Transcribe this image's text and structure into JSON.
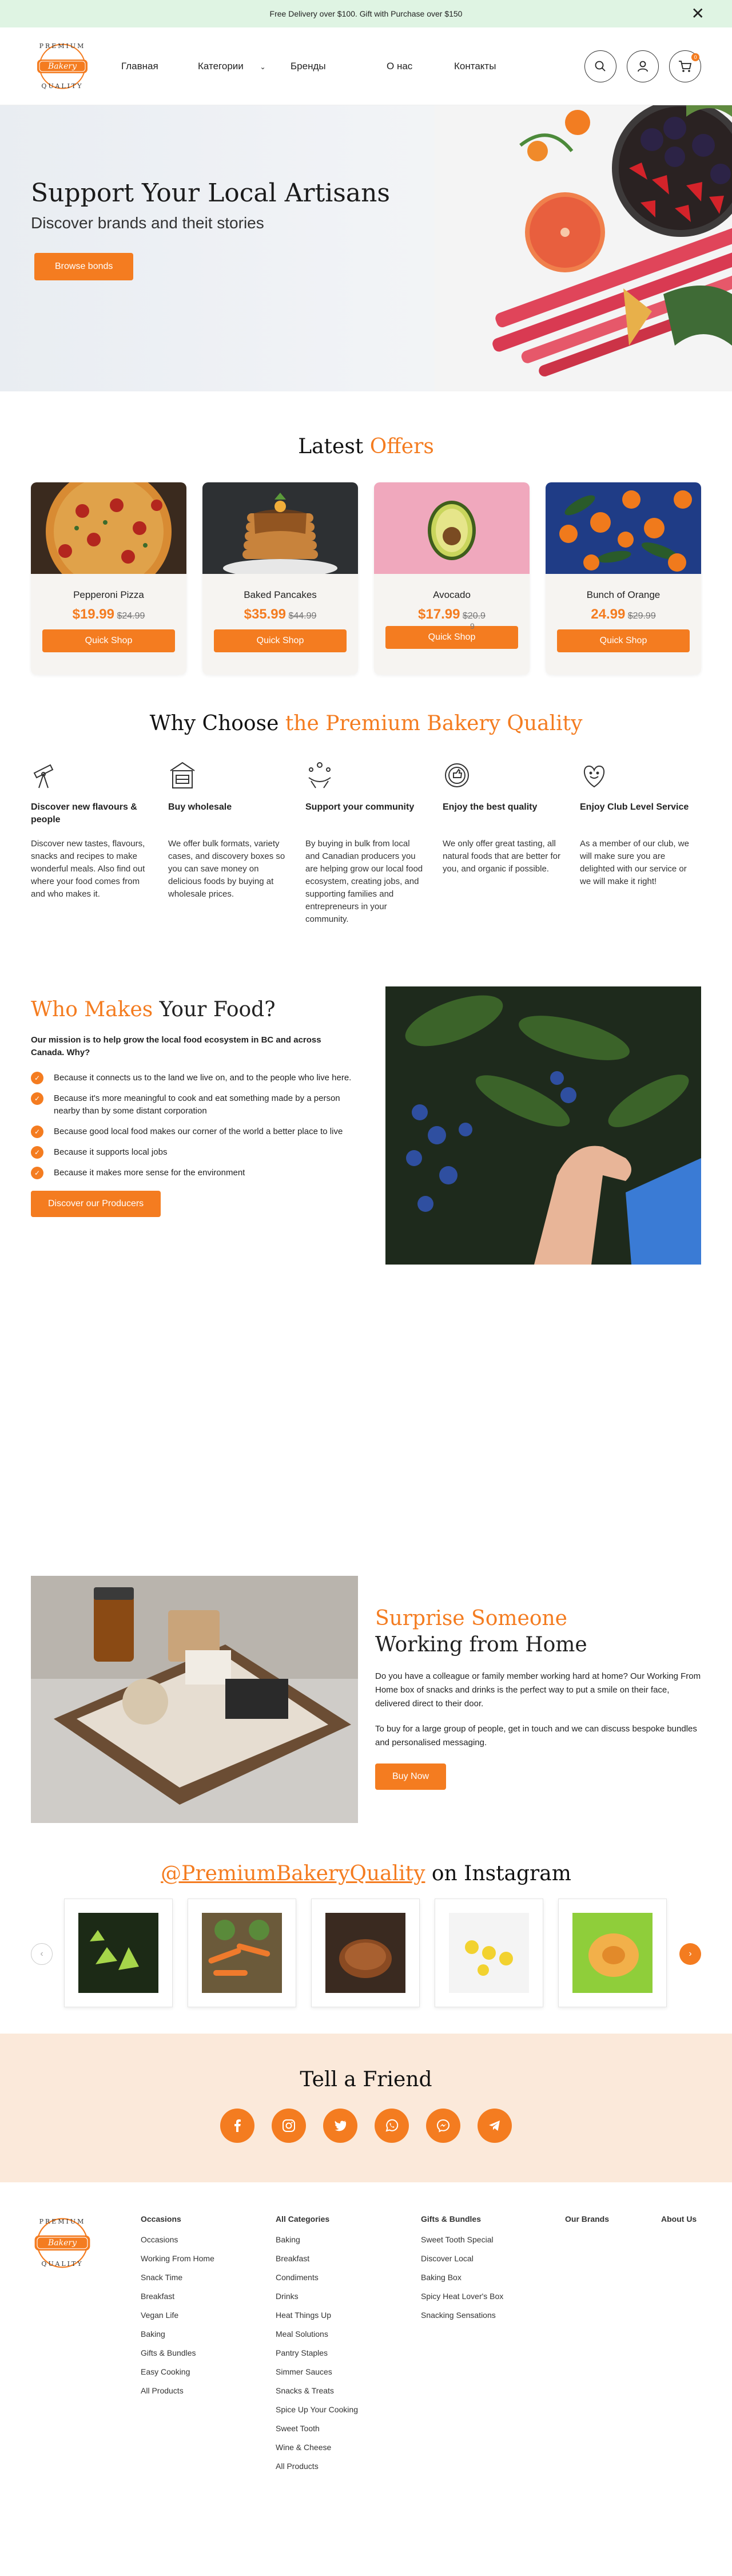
{
  "topbar": {
    "text": "Free Delivery over $100. Gift with Purchase over $150",
    "close": "✕"
  },
  "brand": {
    "top": "PREMIUM",
    "badge": "Bakery",
    "bottom": "QUALITY"
  },
  "nav": {
    "home": "Главная",
    "categories": "Категории",
    "brands": "Бренды",
    "about": "О нас",
    "contacts": "Контакты"
  },
  "header": {
    "cart_count": "0"
  },
  "hero": {
    "title": "Support Your Local Artisans",
    "subtitle": "Discover brands and theit stories",
    "button": "Browse bonds"
  },
  "offers": {
    "title_plain": "Latest ",
    "title_accent": "Offers",
    "items": [
      {
        "name": "Pepperoni Pizza",
        "price": "$19.99",
        "old": "$24.99",
        "button": "Quick Shop"
      },
      {
        "name": "Baked Pancakes",
        "price": "$35.99",
        "old": "$44.99",
        "button": "Quick Shop"
      },
      {
        "name": "Avocado",
        "price": "$17.99",
        "old": "$20.9",
        "extra": "9",
        "button": "Quick Shop"
      },
      {
        "name": "Bunch of Orange",
        "price": "24.99",
        "old": "$29.99",
        "button": "Quick Shop"
      }
    ]
  },
  "why": {
    "title_plain": "Why Choose ",
    "title_accent": "the Premium Bakery Quality",
    "items": [
      {
        "icon": "telescope-icon",
        "title": "Discover new flavours & people",
        "text": "Discover new tastes, flavours, snacks and recipes to make wonderful meals. Also find out where your food comes from and who makes it."
      },
      {
        "icon": "store-icon",
        "title": "Buy wholesale",
        "text": "We offer bulk formats, variety cases, and discovery boxes so you can save money on delicious foods by buying at wholesale prices."
      },
      {
        "icon": "community-icon",
        "title": "Support your community",
        "text": "By buying in bulk from local and Canadian producers you are helping grow our local food ecosystem, creating jobs, and supporting families and entrepreneurs in your community."
      },
      {
        "icon": "quality-badge-icon",
        "title": "Enjoy the best quality",
        "text": "We only offer great tasting, all natural foods that are better for you, and organic if possible."
      },
      {
        "icon": "heart-smile-icon",
        "title": "Enjoy Club Level Service",
        "text": "As a member of our club, we will make sure you are delighted with our service or we will make it right!"
      }
    ]
  },
  "who": {
    "title_accent": "Who Makes",
    "title_plain": " Your Food?",
    "mission": "Our mission is to help grow the local food ecosystem in BC and across Canada.  Why?",
    "reasons": [
      "Because it connects us to the land we live on, and to the people who live here.",
      "Because it's more meaningful to cook and eat something made by a person nearby than by some distant corporation",
      "Because good local food makes our corner of the world a better place to live",
      "Because it supports local jobs",
      "Because it makes more sense for the environment"
    ],
    "button": "Discover our Producers"
  },
  "surprise": {
    "title_accent": "Surprise Someone",
    "title_plain": "Working from Home",
    "p1": "Do you have a colleague or family member working hard at home? Our Working From Home box of snacks and drinks is the perfect way to put a smile on their face, delivered direct to their door.",
    "p2": "To buy for a large group of people, get in touch and we can discuss bespoke bundles and personalised messaging.",
    "button": "Buy Now"
  },
  "instagram": {
    "handle": "@PremiumBakeryQuality",
    "suffix": " on Instagram",
    "prev": "‹",
    "next": "›"
  },
  "tell": {
    "title": "Tell a Friend",
    "networks": [
      "facebook-icon",
      "instagram-icon",
      "twitter-icon",
      "whatsapp-icon",
      "messenger-icon",
      "telegram-icon"
    ]
  },
  "footer": {
    "occasions": {
      "title": "Occasions",
      "links": [
        "Occasions",
        "Working From Home",
        "Snack Time",
        "Breakfast",
        "Vegan Life",
        "Baking",
        "Gifts & Bundles",
        "Easy Cooking",
        "All Products"
      ]
    },
    "categories": {
      "title": "All Categories",
      "links": [
        "Baking",
        "Breakfast",
        "Condiments",
        "Drinks",
        "Heat Things Up",
        "Meal Solutions",
        "Pantry Staples",
        "Simmer Sauces",
        "Snacks & Treats",
        "Spice Up Your Cooking",
        "Sweet Tooth",
        "Wine & Cheese",
        "All Products"
      ]
    },
    "gifts": {
      "title": "Gifts & Bundles",
      "links": [
        "Sweet Tooth Special",
        "Discover Local",
        "Baking Box",
        "Spicy Heat Lover's Box",
        "Snacking Sensations"
      ]
    },
    "brands": {
      "title": "Our Brands"
    },
    "about": {
      "title": "About Us"
    }
  }
}
